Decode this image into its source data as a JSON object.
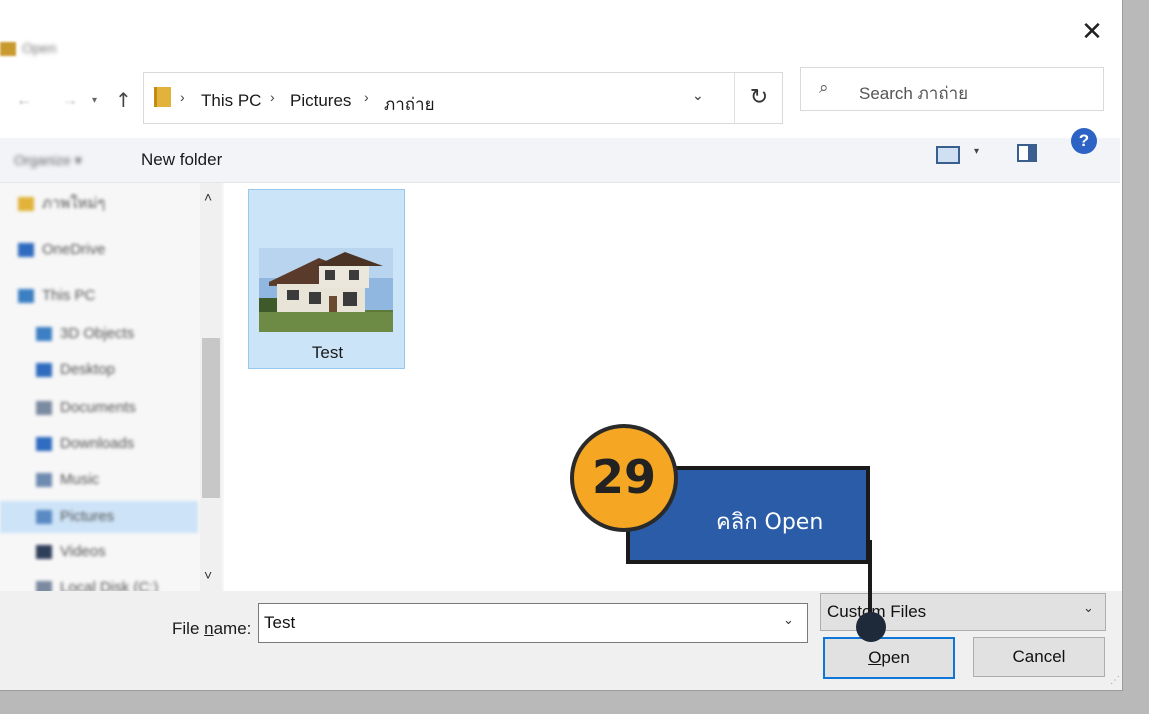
{
  "window": {
    "title": "Open",
    "close_glyph": "✕"
  },
  "nav_buttons": {
    "back": "←",
    "forward": "→",
    "recent": "▾",
    "up": "↑"
  },
  "address": {
    "crumbs": [
      "This PC",
      "Pictures",
      "ภาถ่าย"
    ],
    "separator": "›",
    "dropdown_glyph": "⌄",
    "refresh_glyph": "↻"
  },
  "search": {
    "icon": "search-icon",
    "icon_glyph": "⌕",
    "placeholder": "Search ภาถ่าย"
  },
  "toolbar": {
    "organize_label": "Organize ▾",
    "new_folder_label": "New folder",
    "view_arrow": "▾",
    "help_glyph": "?"
  },
  "nav_pane": {
    "items": [
      {
        "label": "ภาพใหม่ๆ",
        "icon": "folder-icon",
        "color": "#e2b33a"
      },
      {
        "label": "OneDrive",
        "icon": "cloud-icon",
        "color": "#2f6bbf"
      },
      {
        "label": "This PC",
        "icon": "computer-icon",
        "color": "#3c7fc4"
      },
      {
        "label": "3D Objects",
        "icon": "cube-icon",
        "color": "#3c7fc4"
      },
      {
        "label": "Desktop",
        "icon": "desktop-icon",
        "color": "#2f6bbf"
      },
      {
        "label": "Documents",
        "icon": "documents-icon",
        "color": "#7a8aa0"
      },
      {
        "label": "Downloads",
        "icon": "download-icon",
        "color": "#2f6bbf"
      },
      {
        "label": "Music",
        "icon": "music-icon",
        "color": "#6c8bb0"
      },
      {
        "label": "Pictures",
        "icon": "pictures-icon",
        "color": "#5a8ac4"
      },
      {
        "label": "Videos",
        "icon": "video-icon",
        "color": "#2f3f5a"
      },
      {
        "label": "Local Disk (C:)",
        "icon": "disk-icon",
        "color": "#7a8aa0"
      }
    ],
    "selected_index": 8,
    "scroll_up_glyph": "˄",
    "scroll_down_glyph": "˅"
  },
  "files": [
    {
      "name": "Test",
      "type": "image"
    }
  ],
  "bottom": {
    "filename_label_prefix": "File ",
    "filename_label_accel": "n",
    "filename_label_suffix": "ame:",
    "filename_value": "Test",
    "filename_dropdown_glyph": "⌄",
    "filetype_value": "Custom Files",
    "filetype_arrow": "⌄",
    "open_accel": "O",
    "open_rest": "pen",
    "cancel_label": "Cancel",
    "resize_glyph": "⋰"
  },
  "callout": {
    "step_number": "29",
    "text": "คลิก Open",
    "badge_color": "#f5a623",
    "box_color": "#2a5ca8"
  }
}
